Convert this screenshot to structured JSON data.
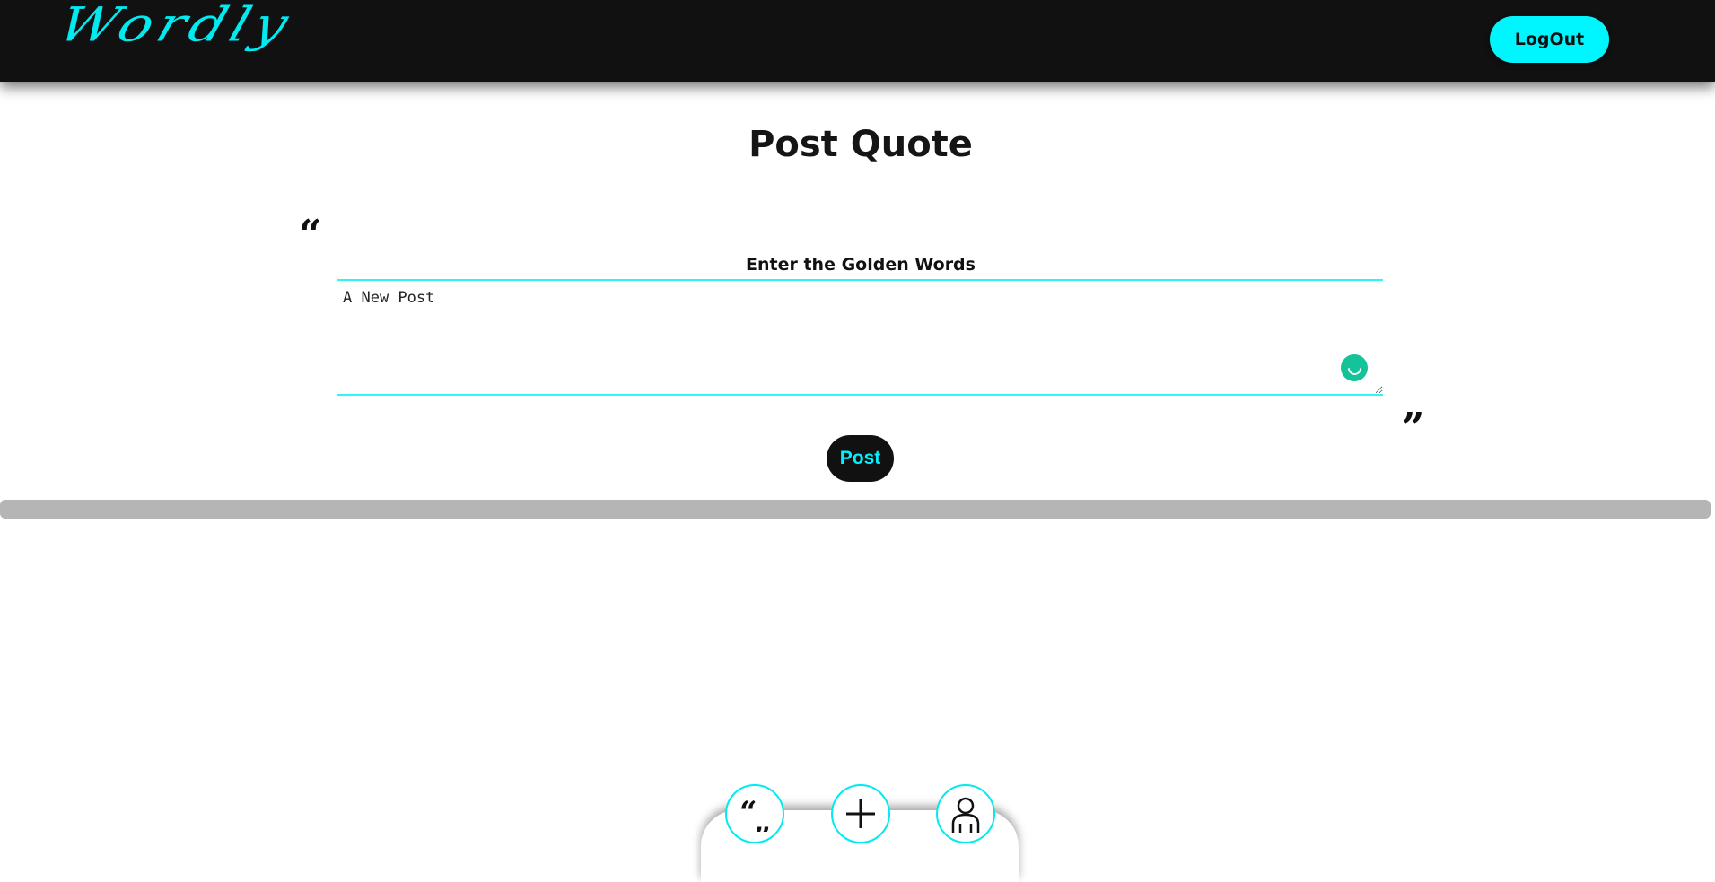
{
  "header": {
    "logo": "Wordly",
    "logout_label": "LogOut"
  },
  "main": {
    "title": "Post Quote",
    "field_label": "Enter the Golden Words",
    "textarea_value": "A New Post",
    "post_label": "Post"
  },
  "bottom_nav": {
    "items": [
      {
        "icon": "quotes-icon"
      },
      {
        "icon": "plus-icon"
      },
      {
        "icon": "user-icon"
      }
    ]
  },
  "colors": {
    "accent": "#00f6ff",
    "header_bg": "#111111",
    "grammar_badge": "#15c39a"
  }
}
